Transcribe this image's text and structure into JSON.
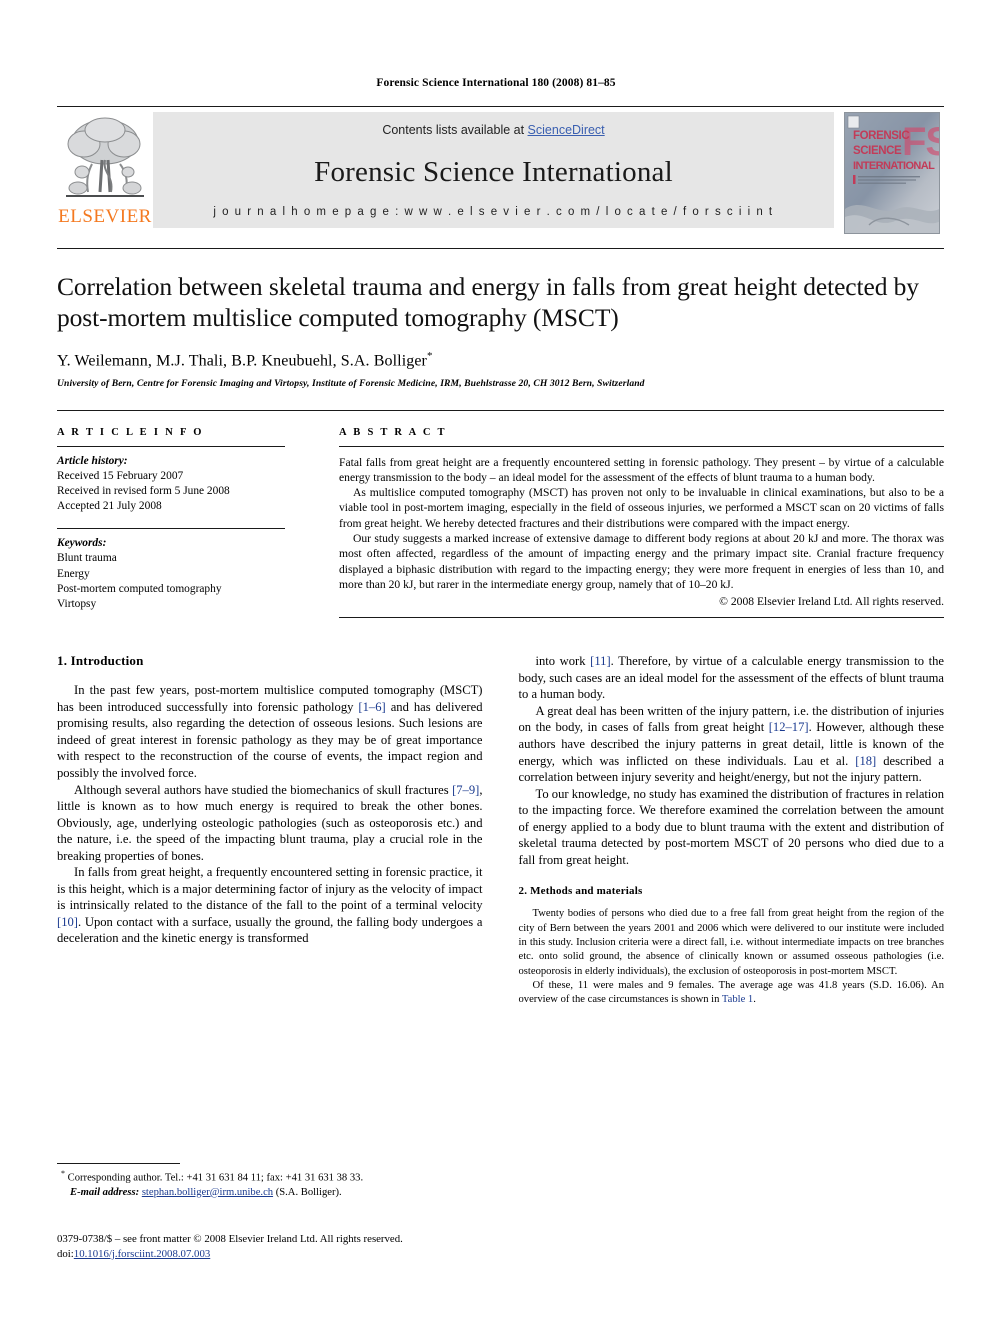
{
  "running_head": "Forensic Science International 180 (2008) 81–85",
  "masthead": {
    "publisher_name": "ELSEVIER",
    "publisher_logo_icon": "elsevier-tree-icon",
    "contents_text": "Contents lists available at ",
    "sciencedirect_link": "ScienceDirect",
    "journal_title": "Forensic Science International",
    "homepage_text": "j o u r n a l   h o m e p a g e :   w w w . e l s e v i e r . c o m / l o c a t e / f o r s c i i n t",
    "cover_thumbnail_icon": "journal-cover-icon",
    "cover_lines": [
      "FORENSIC",
      "SCIENCE",
      "INTERNATIONAL"
    ],
    "cover_watermark": "FSI",
    "link_color": "#3a5fb0",
    "banner_bg": "#e6e6e6",
    "elsevier_orange": "#f47920"
  },
  "article": {
    "title": "Correlation between skeletal trauma and energy in falls from great height detected by post-mortem multislice computed tomography (MSCT)",
    "authors": "Y. Weilemann, M.J. Thali, B.P. Kneubuehl, S.A. Bolliger",
    "corresponding_marker": "*",
    "affiliation": "University of Bern, Centre for Forensic Imaging and Virtopsy, Institute of Forensic Medicine, IRM, Buehlstrasse 20, CH 3012 Bern, Switzerland"
  },
  "article_info": {
    "heading": "A R T I C L E   I N F O",
    "history_label": "Article history:",
    "history": [
      "Received 15 February 2007",
      "Received in revised form 5 June 2008",
      "Accepted 21 July 2008"
    ],
    "keywords_label": "Keywords:",
    "keywords": [
      "Blunt trauma",
      "Energy",
      "Post-mortem computed tomography",
      "Virtopsy"
    ]
  },
  "abstract": {
    "heading": "A B S T R A C T",
    "paragraphs": [
      "Fatal falls from great height are a frequently encountered setting in forensic pathology. They present – by virtue of a calculable energy transmission to the body – an ideal model for the assessment of the effects of blunt trauma to a human body.",
      "As multislice computed tomography (MSCT) has proven not only to be invaluable in clinical examinations, but also to be a viable tool in post-mortem imaging, especially in the field of osseous injuries, we performed a MSCT scan on 20 victims of falls from great height. We hereby detected fractures and their distributions were compared with the impact energy.",
      "Our study suggests a marked increase of extensive damage to different body regions at about 20 kJ and more. The thorax was most often affected, regardless of the amount of impacting energy and the primary impact site. Cranial fracture frequency displayed a biphasic distribution with regard to the impacting energy; they were more frequent in energies of less than 10, and more than 20 kJ, but rarer in the intermediate energy group, namely that of 10–20 kJ."
    ],
    "copyright": "© 2008 Elsevier Ireland Ltd. All rights reserved."
  },
  "sections": {
    "introduction": {
      "heading": "1. Introduction",
      "left_paragraphs": [
        "In the past few years, post-mortem multislice computed tomography (MSCT) has been introduced successfully into forensic pathology [1–6] and has delivered promising results, also regarding the detection of osseous lesions. Such lesions are indeed of great interest in forensic pathology as they may be of great importance with respect to the reconstruction of the course of events, the impact region and possibly the involved force.",
        "Although several authors have studied the biomechanics of skull fractures [7–9], little is known as to how much energy is required to break the other bones. Obviously, age, underlying osteologic pathologies (such as osteoporosis etc.) and the nature, i.e. the speed of the impacting blunt trauma, play a crucial role in the breaking properties of bones.",
        "In falls from great height, a frequently encountered setting in forensic practice, it is this height, which is a major determining factor of injury as the velocity of impact is intrinsically related to the distance of the fall to the point of a terminal velocity [10]. Upon contact with a surface, usually the ground, the falling body undergoes a deceleration and the kinetic energy is transformed"
      ],
      "right_paragraphs": [
        "into work [11]. Therefore, by virtue of a calculable energy transmission to the body, such cases are an ideal model for the assessment of the effects of blunt trauma to a human body.",
        "A great deal has been written of the injury pattern, i.e. the distribution of injuries on the body, in cases of falls from great height [12–17]. However, although these authors have described the injury patterns in great detail, little is known of the energy, which was inflicted on these individuals. Lau et al. [18] described a correlation between injury severity and height/energy, but not the injury pattern.",
        "To our knowledge, no study has examined the distribution of fractures in relation to the impacting force. We therefore examined the correlation between the amount of energy applied to a body due to blunt trauma with the extent and distribution of skeletal trauma detected by post-mortem MSCT of 20 persons who died due to a fall from great height."
      ]
    },
    "methods": {
      "heading": "2. Methods and materials",
      "paragraphs": [
        "Twenty bodies of persons who died due to a free fall from great height from the region of the city of Bern between the years 2001 and 2006 which were delivered to our institute were included in this study. Inclusion criteria were a direct fall, i.e. without intermediate impacts on tree branches etc. onto solid ground, the absence of clinically known or assumed osseous pathologies (i.e. osteoporosis in elderly individuals), the exclusion of osteoporosis in post-mortem MSCT.",
        "Of these, 11 were males and 9 females. The average age was 41.8 years (S.D. 16.06). An overview of the case circumstances is shown in Table 1."
      ],
      "table_ref": "Table 1"
    }
  },
  "footnotes": {
    "corresponding": "Corresponding author. Tel.: +41 31 631 84 11; fax: +41 31 631 38 33.",
    "email_label": "E-mail address:",
    "email": "stephan.bolliger@irm.unibe.ch",
    "email_owner": "(S.A. Bolliger).",
    "imprint": "0379-0738/$ – see front matter © 2008 Elsevier Ireland Ltd. All rights reserved.",
    "doi_label": "doi:",
    "doi": "10.1016/j.forsciint.2008.07.003"
  }
}
